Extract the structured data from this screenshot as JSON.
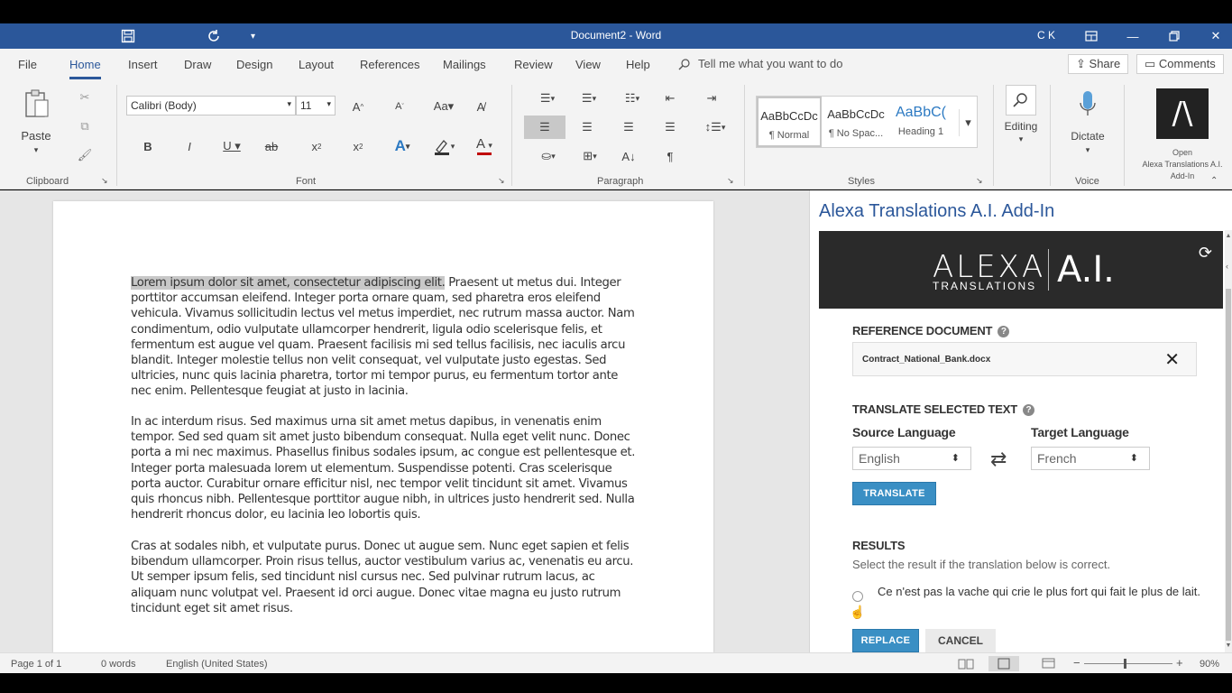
{
  "window": {
    "title": "Document2  -  Word",
    "user_initials": "C K",
    "min_icon": "minimize-icon",
    "restore_icon": "restore-icon",
    "close_icon": "close-icon"
  },
  "menu": {
    "tabs": [
      "File",
      "Home",
      "Insert",
      "Draw",
      "Design",
      "Layout",
      "References",
      "Mailings",
      "Review",
      "View",
      "Help"
    ],
    "active": "Home",
    "tellme": "Tell me what you want to do",
    "share": "Share",
    "comments": "Comments"
  },
  "ribbon": {
    "clipboard": {
      "label": "Clipboard",
      "paste": "Paste"
    },
    "font": {
      "label": "Font",
      "family": "Calibri (Body)",
      "size": "11"
    },
    "paragraph": {
      "label": "Paragraph"
    },
    "styles": {
      "label": "Styles",
      "items": [
        {
          "sample": "AaBbCcDc",
          "name": "¶ Normal"
        },
        {
          "sample": "AaBbCcDc",
          "name": "¶ No Spac..."
        },
        {
          "sample": "AaBbC(",
          "name": "Heading 1"
        }
      ]
    },
    "editing": {
      "label": "Editing"
    },
    "voice": {
      "label": "Voice",
      "dictate": "Dictate"
    },
    "addin": {
      "label_line1": "Open",
      "label_line2": "Alexa Translations A.I.",
      "label_line3": "Add-In"
    }
  },
  "document": {
    "highlighted": "Lorem ipsum dolor sit amet, consectetur adipiscing elit.",
    "para1_rest": " Praesent ut metus dui. Integer porttitor accumsan eleifend. Integer porta ornare quam, sed pharetra eros eleifend vehicula. Vivamus sollicitudin lectus vel metus imperdiet, nec rutrum massa auctor. Nam condimentum, odio vulputate ullamcorper hendrerit, ligula odio scelerisque felis, et fermentum est augue vel quam. Praesent facilisis mi sed tellus facilisis, nec iaculis arcu blandit. Integer molestie tellus non velit consequat, vel vulputate justo egestas. Sed ultricies, nunc quis lacinia pharetra, tortor mi tempor purus, eu fermentum tortor ante nec enim. Pellentesque feugiat at justo in lacinia.",
    "para2": "In ac interdum risus. Sed maximus urna sit amet metus dapibus, in venenatis enim tempor. Sed sed quam sit amet justo bibendum consequat. Nulla eget velit nunc. Donec porta a mi nec maximus. Phasellus finibus sodales ipsum, ac congue est pellentesque et. Integer porta malesuada lorem ut elementum. Suspendisse potenti. Cras scelerisque porta auctor. Curabitur ornare efficitur nisl, nec tempor velit tincidunt sit amet. Vivamus quis rhoncus nibh. Pellentesque porttitor augue nibh, in ultrices justo hendrerit sed. Nulla hendrerit rhoncus dolor, eu lacinia leo lobortis quis.",
    "para3": "Cras at sodales nibh, et vulputate purus. Donec ut augue sem. Nunc eget sapien et felis bibendum ullamcorper. Proin risus tellus, auctor vestibulum varius ac, venenatis eu arcu. Ut semper ipsum felis, sed tincidunt nisl cursus nec. Sed pulvinar rutrum lacus, ac aliquam nunc volutpat vel. Praesent id orci augue. Donec vitae magna eu justo rutrum tincidunt eget sit amet risus."
  },
  "pane": {
    "title": "Alexa Translations A.I. Add-In",
    "logo_main": "ALEXA",
    "logo_sub": "TRANSLATIONS",
    "logo_ai": "A.I.",
    "reference_label": "REFERENCE DOCUMENT",
    "reference_file": "Contract_National_Bank.docx",
    "translate_label": "TRANSLATE SELECTED TEXT",
    "source_label": "Source Language",
    "target_label": "Target Language",
    "source_value": "English",
    "target_value": "French",
    "translate_button": "TRANSLATE",
    "results_label": "RESULTS",
    "results_hint": "Select the result if the translation below is correct.",
    "result_text": "Ce n'est pas la vache qui crie le plus fort qui fait le plus de lait.",
    "replace_button": "REPLACE",
    "cancel_button": "CANCEL"
  },
  "status": {
    "page": "Page 1 of 1",
    "words": "0 words",
    "language": "English (United States)",
    "zoom": "90%"
  },
  "colors": {
    "accent": "#2b579a",
    "pane_button": "#3a8fc4"
  }
}
